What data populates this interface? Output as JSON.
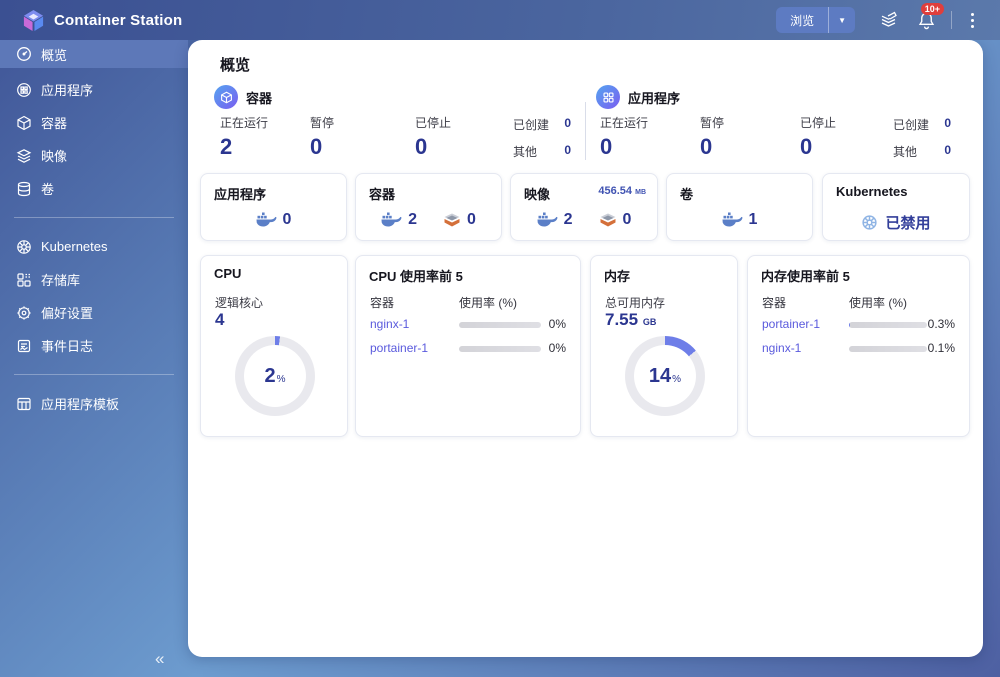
{
  "topbar": {
    "title": "Container Station",
    "browse_label": "浏览",
    "notification_badge": "10+"
  },
  "sidebar": {
    "items": [
      {
        "label": "概览",
        "selected": true
      },
      {
        "label": "应用程序"
      },
      {
        "label": "容器"
      },
      {
        "label": "映像"
      },
      {
        "label": "卷"
      },
      {
        "label": "Kubernetes"
      },
      {
        "label": "存储库"
      },
      {
        "label": "偏好设置"
      },
      {
        "label": "事件日志"
      },
      {
        "label": "应用程序模板"
      }
    ],
    "collapse_glyph": "«"
  },
  "overview": {
    "title": "概览",
    "containers": {
      "label": "容器",
      "stats": [
        {
          "label": "正在运行",
          "value": "2"
        },
        {
          "label": "暂停",
          "value": "0"
        },
        {
          "label": "已停止",
          "value": "0"
        }
      ],
      "mini": [
        {
          "label": "已创建",
          "value": "0"
        },
        {
          "label": "其他",
          "value": "0"
        }
      ]
    },
    "applications": {
      "label": "应用程序",
      "stats": [
        {
          "label": "正在运行",
          "value": "0"
        },
        {
          "label": "暂停",
          "value": "0"
        },
        {
          "label": "已停止",
          "value": "0"
        }
      ],
      "mini": [
        {
          "label": "已创建",
          "value": "0"
        },
        {
          "label": "其他",
          "value": "0"
        }
      ]
    }
  },
  "summary_cards": {
    "apps": {
      "title": "应用程序",
      "docker_count": "0"
    },
    "containers": {
      "title": "容器",
      "docker_count": "2",
      "alt_count": "0"
    },
    "images": {
      "title": "映像",
      "size": "456.54",
      "size_unit": "MB",
      "docker_count": "2",
      "alt_count": "0"
    },
    "volumes": {
      "title": "卷",
      "docker_count": "1"
    },
    "kubernetes": {
      "title": "Kubernetes",
      "status": "已禁用"
    }
  },
  "metric_cards": {
    "cpu": {
      "title": "CPU",
      "sub_label": "逻辑核心",
      "sub_value": "4",
      "percent": 2,
      "percent_text": "2",
      "percent_suffix": "%"
    },
    "cpu_top": {
      "title": "CPU 使用率前 5",
      "col_name": "容器",
      "col_usage": "使用率 (%)",
      "rows": [
        {
          "name": "nginx-1",
          "pct_label": "0%",
          "fill": 0
        },
        {
          "name": "portainer-1",
          "pct_label": "0%",
          "fill": 0
        }
      ]
    },
    "memory": {
      "title": "内存",
      "sub_label": "总可用内存",
      "sub_value": "7.55",
      "sub_unit": "GB",
      "percent": 14,
      "percent_text": "14",
      "percent_suffix": "%"
    },
    "memory_top": {
      "title": "内存使用率前 5",
      "col_name": "容器",
      "col_usage": "使用率 (%)",
      "rows": [
        {
          "name": "portainer-1",
          "pct_label": "0.3%",
          "fill": 0.3
        },
        {
          "name": "nginx-1",
          "pct_label": "0.1%",
          "fill": 0.1
        }
      ]
    }
  },
  "colors": {
    "donut_arc": "#6e7ee8",
    "donut_track": "#e9e9ee",
    "accent_navy": "#2b3690",
    "link": "#5a5add",
    "docker_blue": "#5b7fc7",
    "badge_red": "#e03e3c"
  }
}
